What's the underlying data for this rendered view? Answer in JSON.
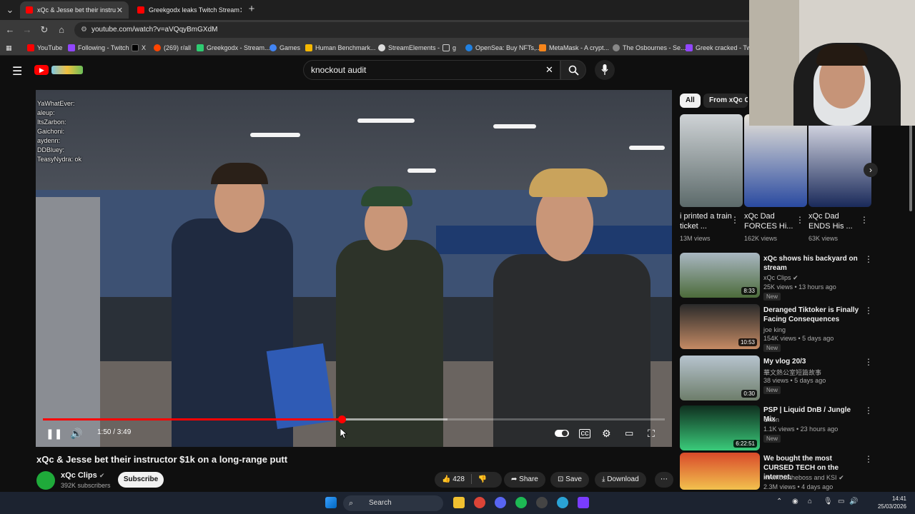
{
  "browser": {
    "tabs": [
      {
        "label": "xQc & Jesse bet their instru",
        "active": true
      },
      {
        "label": "Greekgodx leaks Twitch Stream",
        "active": false
      }
    ],
    "new_tab": "+",
    "url": "youtube.com/watch?v=aVQqyBmGXdM",
    "bookmarks": [
      "YouTube",
      "Following - Twitch",
      "X",
      "(269) r/all",
      "Greekgodx - Stream...",
      "Games",
      "Human Benchmark...",
      "StreamElements -",
      "g",
      "OpenSea: Buy NFTs,...",
      "MetaMask - A crypt...",
      "The Osbournes - Se...",
      "Greek cracked - Twi..."
    ]
  },
  "search": {
    "value": "knockout audit"
  },
  "player": {
    "chat": [
      "YaWhatEver:",
      "aleup:",
      "ItsZarbon:",
      "Gaichoni:",
      "aydenn:",
      "DDBluey:",
      "TeasyNydra: ok"
    ],
    "time": "1:50 / 3:49",
    "progress": 0.48,
    "buffered": 0.65
  },
  "video": {
    "title": "xQc & Jesse bet their instructor $1k on a long-range putt",
    "channel": "xQc Clips",
    "subscribers": "392K subscribers",
    "subscribe_label": "Subscribe",
    "likes": "428",
    "share_label": "Share",
    "save_label": "Save",
    "download_label": "Download"
  },
  "chips": [
    "All",
    "From xQc Clips"
  ],
  "shelf": [
    {
      "title": "i printed a train ticket ...",
      "views": "13M views"
    },
    {
      "title": "xQc Dad FORCES Hi...",
      "views": "162K views"
    },
    {
      "title": "xQc Dad ENDS His ...",
      "views": "63K views"
    }
  ],
  "recommendations": [
    {
      "title": "xQc shows his backyard on stream",
      "channel": "xQc Clips",
      "meta": "25K views • 13 hours ago",
      "badge": "New",
      "duration": "8:33"
    },
    {
      "title": "Deranged Tiktoker is Finally Facing Consequences",
      "channel": "joe king",
      "meta": "154K views • 5 days ago",
      "badge": "New",
      "duration": "10:53"
    },
    {
      "title": "My vlog 20/3",
      "channel": "華文熱公室短篇故事",
      "meta": "38 views • 5 days ago",
      "badge": "New",
      "duration": "0:30"
    },
    {
      "title": "PSP | Liquid DnB / Jungle Mix",
      "channel": "Orion",
      "meta": "1.1K views • 23 hours ago",
      "badge": "New",
      "duration": "6:22:51"
    },
    {
      "title": "We bought the most CURSED TECH on the internet.",
      "channel": "Mrwhosetheboss and KSI",
      "meta": "2.3M views • 4 days ago",
      "badge": "",
      "duration": ""
    }
  ],
  "taskbar": {
    "search": "Search",
    "time": "14:41",
    "date": "25/03/2026"
  },
  "colors": {
    "accent": "#ff0000",
    "background": "#0f0f0f"
  }
}
